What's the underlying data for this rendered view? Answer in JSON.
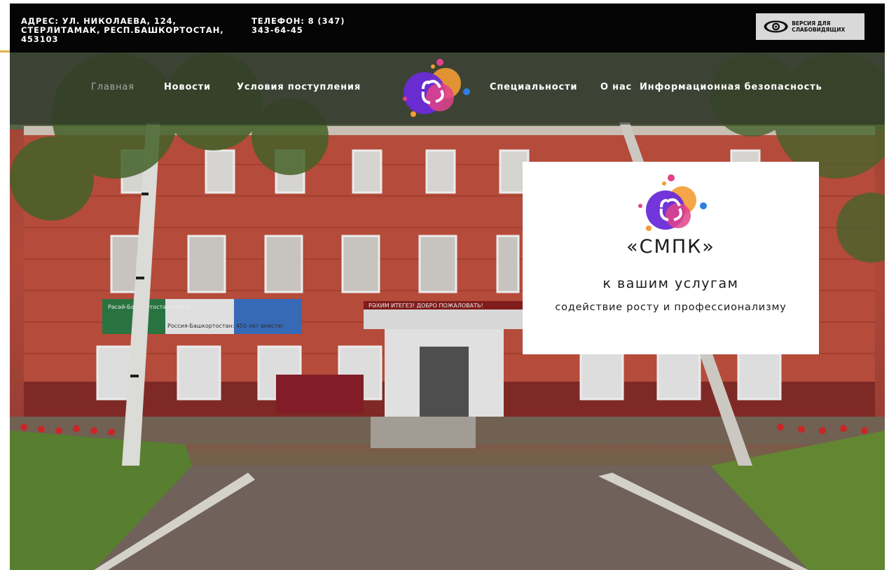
{
  "topbar": {
    "address": "Адрес: ул. Николаева, 124, Стерлитамак, Респ.Башкортостан, 453103",
    "phone": "Телефон: 8 (347) 343-64-45",
    "accessibility_label": "Версия для слабовидящих"
  },
  "nav": {
    "items": [
      {
        "label": "Главная",
        "active": true
      },
      {
        "label": "Новости"
      },
      {
        "label": "Условия поступления"
      },
      {
        "label": "Специальности"
      },
      {
        "label": "О нас"
      },
      {
        "label": "Информационная безопасность"
      }
    ],
    "logo_icon": "college-logo-icon"
  },
  "hero": {
    "banner_left": "Россия-Башкортостан: 450 лет вместе!",
    "banner_left_top": "Рәсәй-Башкортостан берге!",
    "entrance_sign": "РӘХИМ ИТЕГЕЗ!  ДОБРО ПОЖАЛОВАТЬ!"
  },
  "card": {
    "title": "«СМПК»",
    "subtitle": "к вашим услугам",
    "tagline": "содействие росту и профессионализму"
  },
  "colors": {
    "topbar_bg": "#050505",
    "accent_gold": "#e3b04b",
    "logo_purple": "#6a2bd9",
    "logo_orange": "#f39c34",
    "logo_pink": "#e2438a",
    "logo_blue": "#2f7de1"
  }
}
